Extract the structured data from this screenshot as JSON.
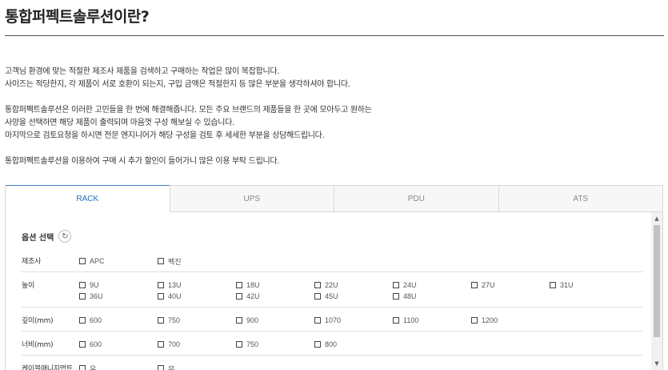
{
  "page": {
    "title": "통합퍼펙트솔루션이란?"
  },
  "intro": {
    "p1_line1": "고객님 환경에 맞는 적절한 제조사 제품을 검색하고 구매하는 작업은 많이 복잡합니다.",
    "p1_line2": "사이즈는 적당한지, 각 제품이 서로 호환이 되는지, 구입 금액은 적절한지 등 많은 부분을 생각하셔야 합니다.",
    "p2_line1": "통합퍼펙트솔루션은 이러한 고민들을 한 번에 해결해줍니다. 모든 주요 브랜드의 제품들을 한 곳에 모아두고 원하는",
    "p2_line2": "사양을 선택하면 해당 제품이 출력되며 마음껏 구성 해보실 수 있습니다.",
    "p2_line3": "마지막으로 검토요청을 하시면 전문 엔지니어가 해당 구성을 검토 후 세세한 부분을 상담해드립니다.",
    "p3_line1": "통합퍼펙트솔루션을 이용하여 구매 시 추가 할인이 들어가니 많은 이용 부탁 드립니다."
  },
  "tabs": [
    {
      "label": "RACK",
      "active": true
    },
    {
      "label": "UPS",
      "active": false
    },
    {
      "label": "PDU",
      "active": false
    },
    {
      "label": "ATS",
      "active": false
    }
  ],
  "options": {
    "title": "옵션 선택",
    "refresh_icon": "refresh-icon",
    "rows": [
      {
        "label": "제조사",
        "items": [
          "APC",
          "벡진"
        ]
      },
      {
        "label": "높이",
        "items": [
          "9U",
          "13U",
          "18U",
          "22U",
          "24U",
          "27U",
          "31U",
          "36U",
          "40U",
          "42U",
          "45U",
          "48U"
        ]
      },
      {
        "label": "깊이(mm)",
        "items": [
          "600",
          "750",
          "900",
          "1070",
          "1100",
          "1200"
        ]
      },
      {
        "label": "너비(mm)",
        "items": [
          "600",
          "700",
          "750",
          "800"
        ]
      },
      {
        "label": "케이블매니지먼트",
        "items": [
          "유",
          "무"
        ]
      }
    ]
  },
  "colors": {
    "accent": "#1f6fb8",
    "title_rule": "#555555"
  }
}
